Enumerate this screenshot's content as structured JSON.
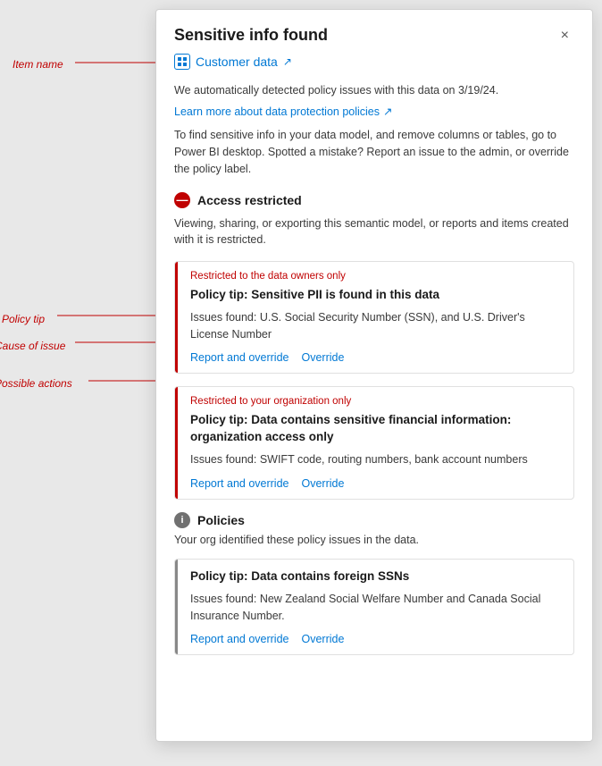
{
  "dialog": {
    "title": "Sensitive info found",
    "close_label": "×",
    "item": {
      "name": "Customer data",
      "external_link_icon": "↗"
    },
    "auto_detect_text": "We automatically detected policy issues with this data on 3/19/24.",
    "learn_more_link": "Learn more about data protection policies",
    "learn_more_icon": "↗",
    "instructions": "To find sensitive info in your data model, and remove columns or tables, go to Power BI desktop. Spotted a mistake? Report an issue to the admin, or override the policy label.",
    "access_restricted": {
      "icon": "—",
      "title": "Access restricted",
      "description": "Viewing, sharing, or exporting this semantic model, or reports and items created with it is restricted."
    },
    "policy_cards": [
      {
        "restricted_label": "Restricted to the data owners only",
        "tip_title": "Policy tip: Sensitive PII is found in this data",
        "issues_label": "Issues found: U.S. Social Security Number (SSN), and U.S. Driver's License Number",
        "action1": "Report and override",
        "action2": "Override"
      },
      {
        "restricted_label": "Restricted to your organization only",
        "tip_title": "Policy tip: Data contains sensitive financial information: organization access only",
        "issues_label": "Issues found: SWIFT code, routing numbers, bank account numbers",
        "action1": "Report and override",
        "action2": "Override"
      }
    ],
    "policies_section": {
      "icon": "i",
      "title": "Policies",
      "description": "Your org identified these policy issues in the data.",
      "cards": [
        {
          "tip_title": "Policy tip: Data contains foreign SSNs",
          "issues_label": "Issues found: New Zealand Social Welfare Number and Canada Social Insurance Number.",
          "action1": "Report and override",
          "action2": "Override"
        }
      ]
    }
  },
  "annotations": {
    "item_name": "Item name",
    "policy_tip": "Policy tip",
    "cause_of_issue": "Cause of issue",
    "possible_actions": "Possible actions"
  }
}
